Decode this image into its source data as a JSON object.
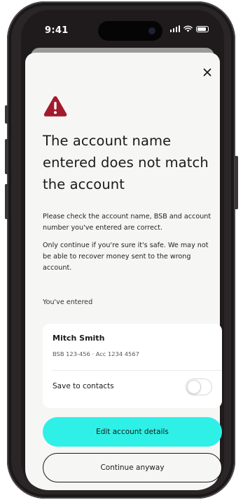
{
  "status_bar": {
    "time": "9:41"
  },
  "dialog": {
    "title": "The account name entered does not match the account",
    "message_1": "Please check the account name, BSB and account number you've entered are correct.",
    "message_2": "Only continue if you're sure it's safe. We may not be able to recover money sent to the wrong account.",
    "entered_label": "You've entered",
    "warning_color": "#a31a2c"
  },
  "account": {
    "name": "Mitch Smith",
    "details": "BSB 123-456 · Acc 1234 4567",
    "save_label": "Save to contacts",
    "save_enabled": false
  },
  "actions": {
    "primary_label": "Edit account details",
    "primary_color": "#2ef0e6",
    "secondary_label": "Continue anyway"
  },
  "icons": {
    "close": "close-icon",
    "warning": "warning-icon",
    "signal": "signal-icon",
    "wifi": "wifi-icon",
    "battery": "battery-icon"
  }
}
